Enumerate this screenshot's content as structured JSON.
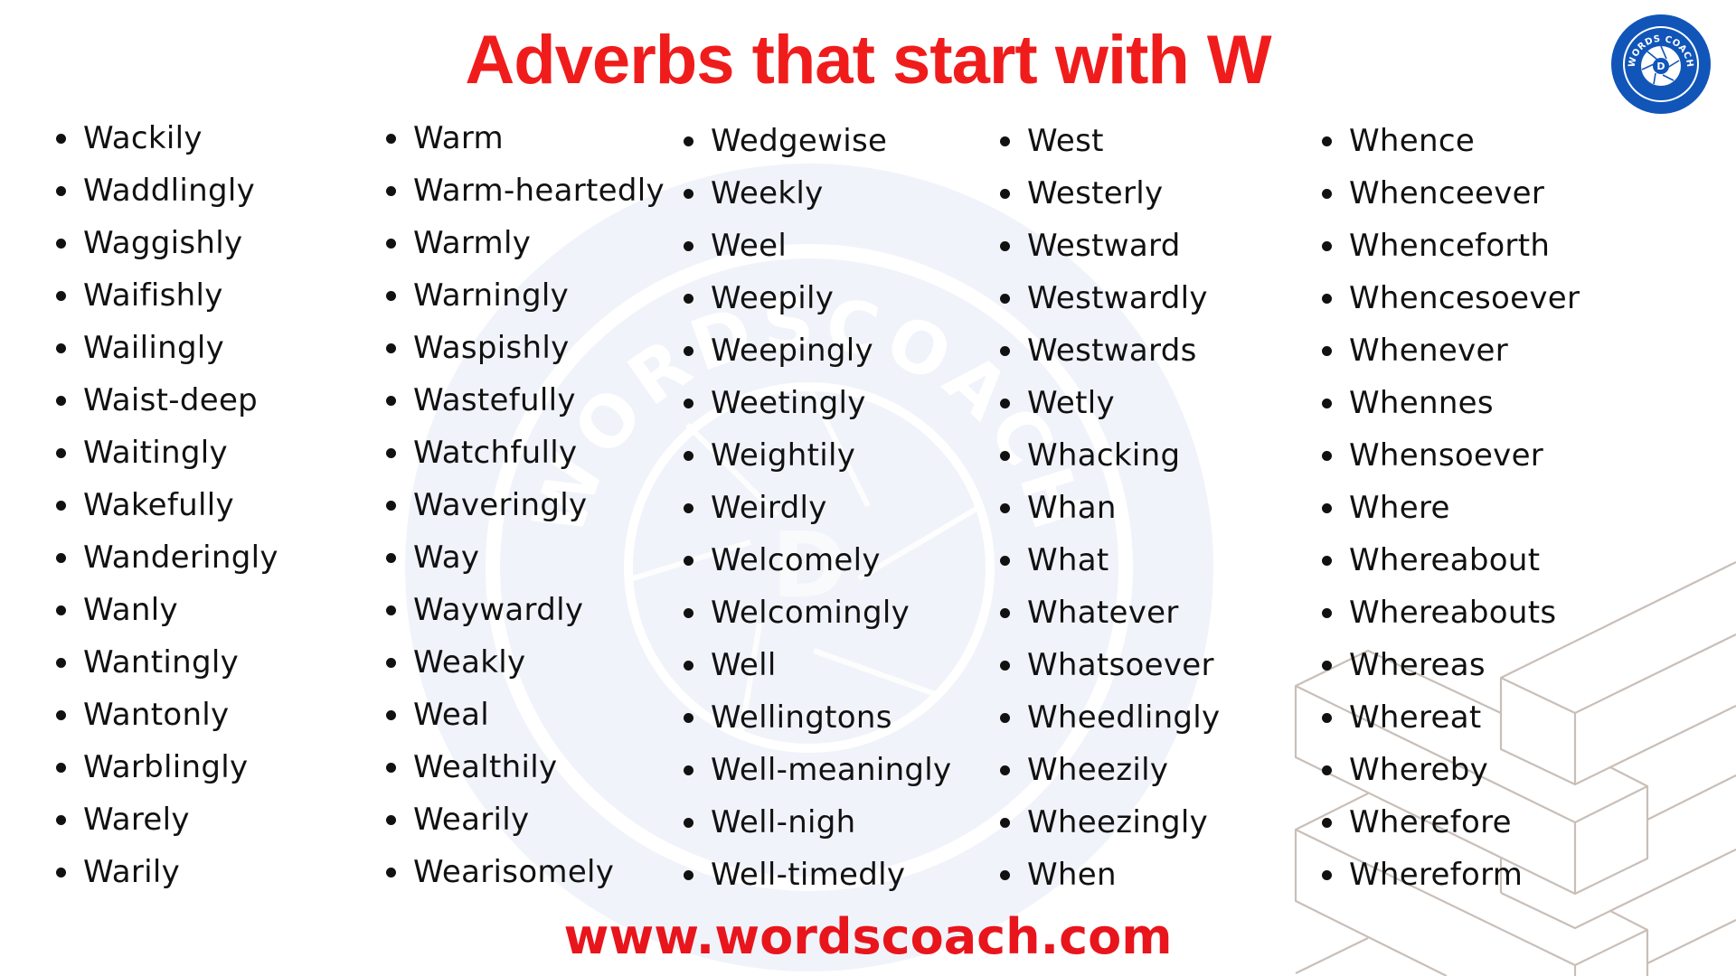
{
  "title": "Adverbs that start with W",
  "logo": {
    "text": "WORDS COACH",
    "letter": "D",
    "color": "#1155b9"
  },
  "watermark_text": "WORDSCOACH",
  "columns": [
    [
      "Wackily",
      "Waddlingly",
      "Waggishly",
      "Waifishly",
      "Wailingly",
      "Waist-deep",
      "Waitingly",
      "Wakefully",
      "Wanderingly",
      "Wanly",
      "Wantingly",
      "Wantonly",
      "Warblingly",
      "Warely",
      "Warily"
    ],
    [
      "Warm",
      "Warm-heartedly",
      "Warmly",
      "Warningly",
      "Waspishly",
      "Wastefully",
      "Watchfully",
      "Waveringly",
      "Way",
      "Waywardly",
      "Weakly",
      "Weal",
      "Wealthily",
      "Wearily",
      "Wearisomely"
    ],
    [
      "Wedgewise",
      "Weekly",
      "Weel",
      "Weepily",
      "Weepingly",
      "Weetingly",
      "Weightily",
      "Weirdly",
      "Welcomely",
      "Welcomingly",
      "Well",
      "Wellingtons",
      "Well-meaningly",
      "Well-nigh",
      "Well-timedly"
    ],
    [
      "West",
      "Westerly",
      "Westward",
      "Westwardly",
      "Westwards",
      "Wetly",
      "Whacking",
      "Whan",
      "What",
      "Whatever",
      "Whatsoever",
      "Wheedlingly",
      "Wheezily",
      "Wheezingly",
      "When"
    ],
    [
      "Whence",
      "Whenceever",
      "Whenceforth",
      "Whencesoever",
      "Whenever",
      "Whennes",
      "Whensoever",
      "Where",
      "Whereabout",
      "Whereabouts",
      "Whereas",
      "Whereat",
      "Whereby",
      "Wherefore",
      "Whereform"
    ]
  ],
  "footer_url": "www.wordscoach.com",
  "colors": {
    "title": "#f01c1c",
    "footer": "#e8151c",
    "text": "#111111",
    "watermark": "#f0f3f9",
    "decoration": "#c9bfb8"
  }
}
